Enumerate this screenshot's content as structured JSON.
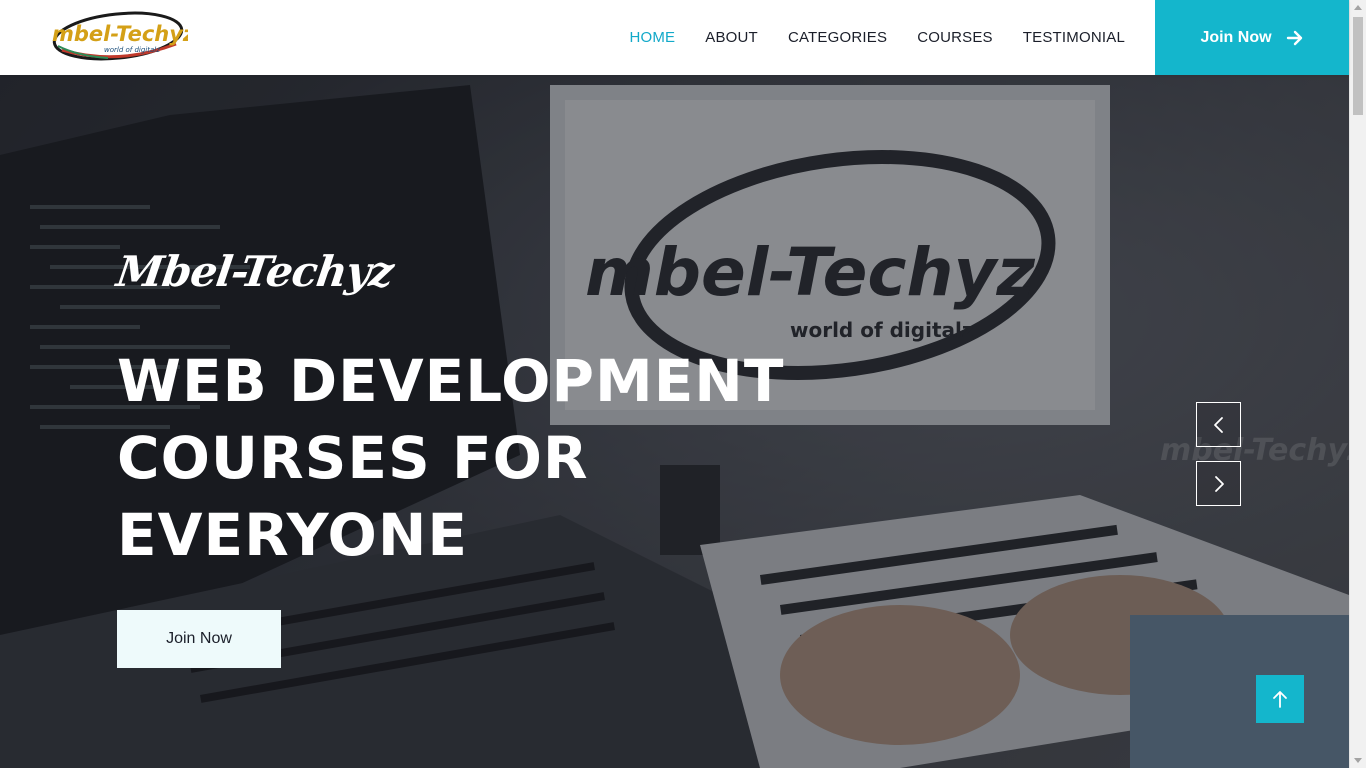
{
  "brand": {
    "logo_text": "mbel-Techyz",
    "logo_tagline": "world of digitalz"
  },
  "nav": {
    "items": [
      {
        "label": "HOME",
        "active": true
      },
      {
        "label": "ABOUT",
        "active": false
      },
      {
        "label": "CATEGORIES",
        "active": false
      },
      {
        "label": "COURSES",
        "active": false
      },
      {
        "label": "TESTIMONIAL",
        "active": false
      }
    ],
    "join_label": "Join Now"
  },
  "hero": {
    "script_title": "Mbel-Techyz",
    "headline_lines": [
      "WEB DEVELOPMENT",
      "COURSES FOR",
      "EVERYONE"
    ],
    "button_label": "Join Now",
    "bg_monitor_text": "mbel-Techyz",
    "bg_monitor_tagline": "world of digitalz",
    "bg_watermark_text": "mbel-Techyz"
  },
  "icons": {
    "join_arrow": "arrow-right-icon",
    "prev": "chevron-left-icon",
    "next": "chevron-right-icon",
    "to_top": "arrow-up-icon"
  },
  "colors": {
    "accent": "#14b6cc",
    "nav_active": "#12a9c9",
    "nav_text": "#1b1f2a",
    "hero_button_bg": "#eefafb"
  }
}
